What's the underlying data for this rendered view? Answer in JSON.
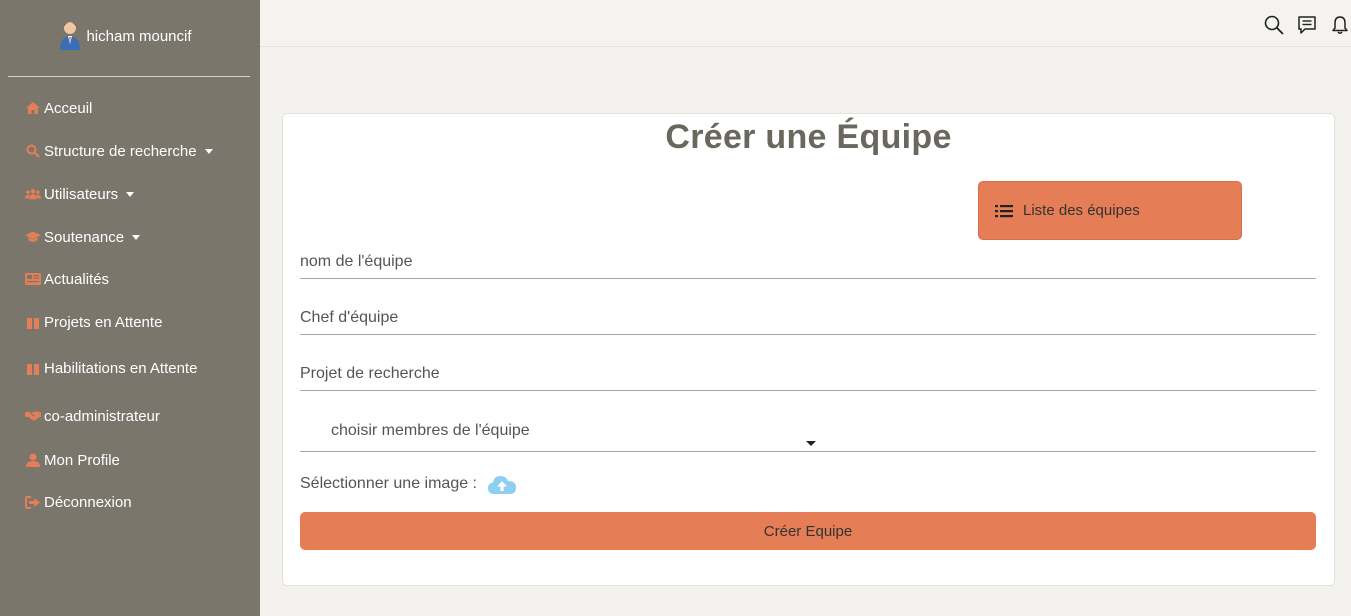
{
  "user": {
    "name": "hicham mouncif"
  },
  "sidebar": {
    "items": [
      {
        "label": "Acceuil",
        "icon": "home-icon"
      },
      {
        "label": "Structure de recherche",
        "icon": "search-icon",
        "dropdown": true
      },
      {
        "label": "Utilisateurs",
        "icon": "users-icon",
        "dropdown": true
      },
      {
        "label": "Soutenance",
        "icon": "graduation-cap-icon",
        "dropdown": true
      },
      {
        "label": "Actualités",
        "icon": "newspaper-icon"
      },
      {
        "label": "Projets en Attente",
        "icon": "pause-icon"
      },
      {
        "label": "Habilitations en Attente",
        "icon": "pause-icon"
      },
      {
        "label": "co-administrateur",
        "icon": "handshake-icon"
      },
      {
        "label": "Mon Profile",
        "icon": "user-icon"
      },
      {
        "label": "Déconnexion",
        "icon": "sign-out-icon"
      }
    ]
  },
  "topbar": {
    "icons": [
      "search-icon",
      "comment-icon",
      "bell-icon"
    ]
  },
  "form": {
    "title": "Créer une Équipe",
    "list_button": "Liste des équipes",
    "team_name_placeholder": "nom de l'équipe",
    "team_lead_placeholder": "Chef d'équipe",
    "project_placeholder": "Projet de recherche",
    "members_select": "choisir membres de l'équipe",
    "image_label": "Sélectionner une image :",
    "submit": "Créer Equipe"
  },
  "colors": {
    "sidebar_bg": "#7a766b",
    "accent": "#e57e56",
    "page_bg": "#f3f2ef",
    "upload_icon": "#8ccff2"
  }
}
